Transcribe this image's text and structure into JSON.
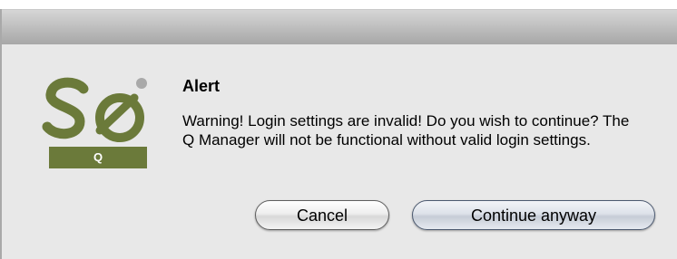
{
  "logo": {
    "letters": "Se",
    "bar_label": "Q",
    "color": "#6b7a3a"
  },
  "alert": {
    "title": "Alert",
    "message": "Warning! Login settings are invalid! Do you wish to continue? The Q Manager will not be functional without valid login settings."
  },
  "buttons": {
    "cancel": "Cancel",
    "continue": "Continue anyway"
  }
}
